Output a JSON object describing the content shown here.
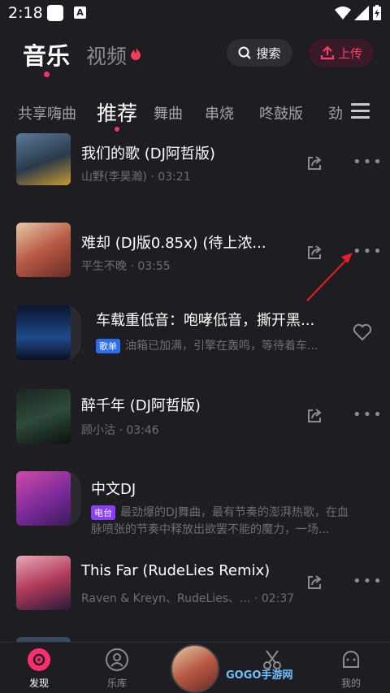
{
  "status": {
    "time": "2:18"
  },
  "header": {
    "tab_music": "音乐",
    "tab_video": "视频",
    "search_label": "搜索",
    "upload_label": "上传"
  },
  "categories": [
    "共享嗨曲",
    "推荐",
    "舞曲",
    "串烧",
    "咚鼓版",
    "劲"
  ],
  "songs": [
    {
      "title": "我们的歌 (DJ阿哲版)",
      "artist": "山野(李昊瀚)",
      "duration": "03:21"
    },
    {
      "title": "难却 (DJ版0.85x) (待上浓...",
      "artist": "平生不晚",
      "duration": "03:55"
    },
    {
      "title": "车载重低音：咆哮低音，撕开黑...",
      "badge": "歌单",
      "desc": "油箱已加满，引擎在轰鸣，等待着车..."
    },
    {
      "title": "醉千年 (DJ阿哲版)",
      "artist": "顾小沽",
      "duration": "03:46"
    },
    {
      "title": "中文DJ",
      "badge": "电台",
      "desc_line1": "最劲爆的DJ舞曲，最有节奏的澎湃热歌，在血",
      "desc_line2": "脉喷张的节奏中释放出欲罢不能的魔力，一场..."
    },
    {
      "title": "This Far (RudeLies Remix)",
      "artist": "Raven & Kreyn、RudeLies、...",
      "duration": "02:37"
    }
  ],
  "nav": {
    "discover": "发现",
    "library": "乐库",
    "mine": "我的"
  },
  "watermark": "GOGO手游网",
  "colors": {
    "accent": "#ff2f6e",
    "background": "#1e1d22",
    "badge_playlist": "#2b6ff0",
    "badge_radio": "#8a3ff5"
  }
}
